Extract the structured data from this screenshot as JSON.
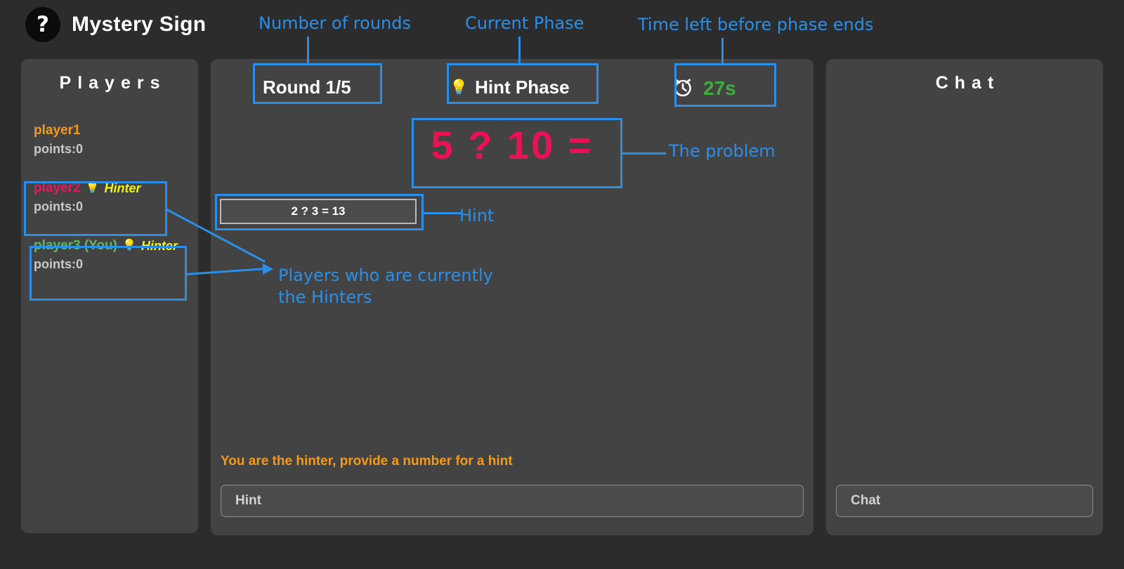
{
  "header": {
    "logo_glyph": "?",
    "logo_icon_name": "question-mark-logo",
    "title": "Mystery Sign"
  },
  "players_panel": {
    "title": "Players",
    "points_prefix": "points:",
    "hinter_tag": "Hinter",
    "bulb_glyph": "💡",
    "players": [
      {
        "name": "player1",
        "color": "#f39a1c",
        "points": "points:0",
        "is_hinter": false
      },
      {
        "name": "player2",
        "color": "#ec1464",
        "points": "points:0",
        "is_hinter": true,
        "hinter_label": "Hinter"
      },
      {
        "name": "player3 (You)",
        "color": "#5dbb5d",
        "points": "points:0",
        "is_hinter": true,
        "hinter_label": "Hinter"
      }
    ]
  },
  "game_panel": {
    "round_label": "Round 1/5",
    "phase_label": "Hint Phase",
    "phase_bulb_glyph": "💡",
    "timer_icon_name": "alarm-clock-icon",
    "timer_value": "27s",
    "timer_color": "#3fae3f",
    "problem_text": "5 ? 10 =",
    "problem_color": "#ea1254",
    "hint_value": "2 ? 3 = 13",
    "hinter_prompt": "You are the hinter, provide a number for a hint",
    "hint_input_placeholder": "Hint",
    "hint_input_value": ""
  },
  "chat_panel": {
    "title": "Chat",
    "chat_input_placeholder": "Chat",
    "chat_input_value": "",
    "messages": []
  },
  "annotations": {
    "accent_color": "#2b8fe8",
    "rounds": "Number of rounds",
    "phase": "Current Phase",
    "time": "Time left before phase ends",
    "problem": "The problem",
    "hint": "Hint",
    "hinters": "Players who are currently\nthe Hinters"
  }
}
